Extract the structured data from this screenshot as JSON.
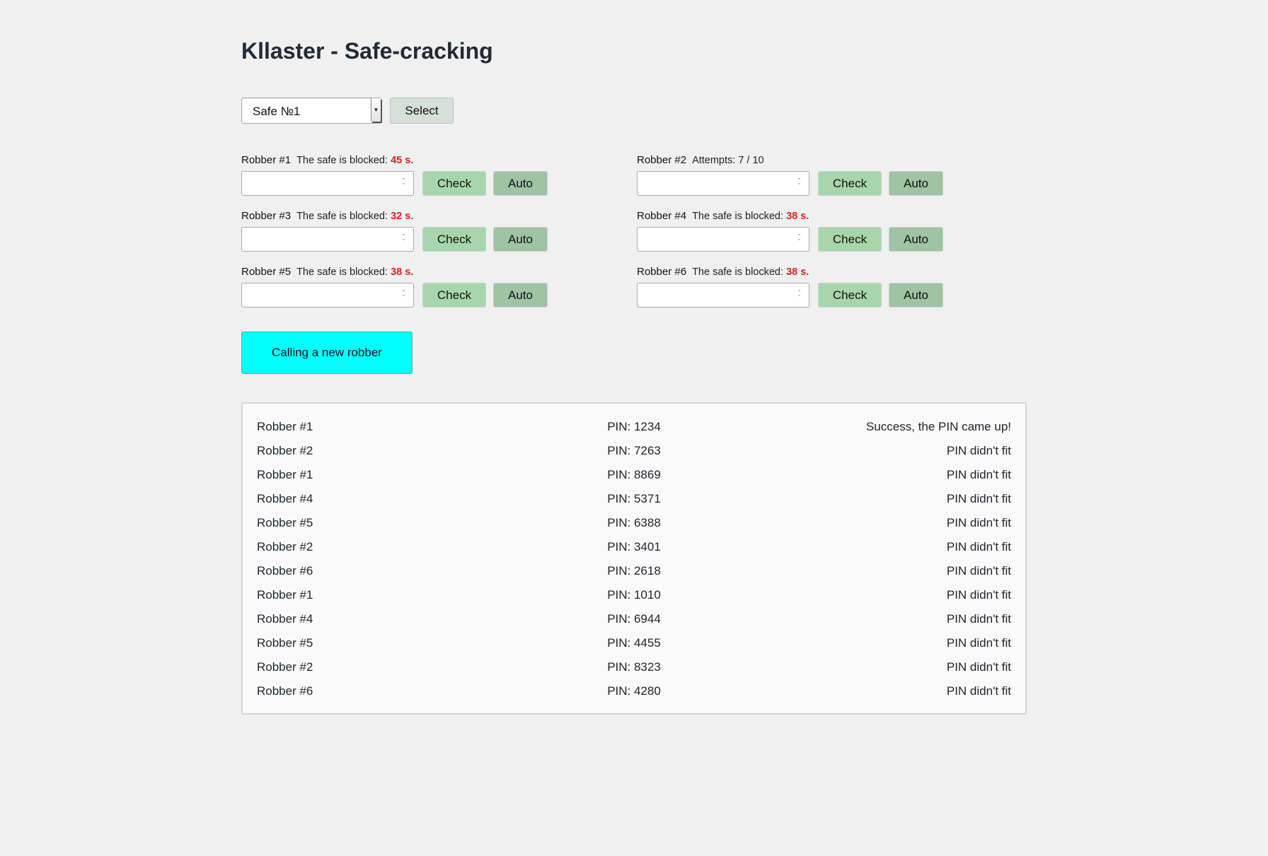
{
  "page_title": "Kllaster - Safe-cracking",
  "safe_select": {
    "value": "Safe №1",
    "button_label": "Select"
  },
  "robbers": [
    {
      "name": "Robber #1",
      "status": "The safe is blocked: ",
      "seconds": "45 s.",
      "check_label": "Check",
      "auto_label": "Auto"
    },
    {
      "name": "Robber #2",
      "status": "Attempts: 7 / 10",
      "seconds": "",
      "check_label": "Check",
      "auto_label": "Auto"
    },
    {
      "name": "Robber #3",
      "status": "The safe is blocked: ",
      "seconds": "32 s.",
      "check_label": "Check",
      "auto_label": "Auto"
    },
    {
      "name": "Robber #4",
      "status": "The safe is blocked: ",
      "seconds": "38 s.",
      "check_label": "Check",
      "auto_label": "Auto"
    },
    {
      "name": "Robber #5",
      "status": "The safe is blocked: ",
      "seconds": "38 s.",
      "check_label": "Check",
      "auto_label": "Auto"
    },
    {
      "name": "Robber #6",
      "status": "The safe is blocked: ",
      "seconds": "38 s.",
      "check_label": "Check",
      "auto_label": "Auto"
    }
  ],
  "call_button_label": "Calling a new robber",
  "log": [
    {
      "robber": "Robber #1",
      "pin": "PIN: 1234",
      "result": "Success, the PIN came up!"
    },
    {
      "robber": "Robber #2",
      "pin": "PIN: 7263",
      "result": "PIN didn't fit"
    },
    {
      "robber": "Robber #1",
      "pin": "PIN: 8869",
      "result": "PIN didn't fit"
    },
    {
      "robber": "Robber #4",
      "pin": "PIN: 5371",
      "result": "PIN didn't fit"
    },
    {
      "robber": "Robber #5",
      "pin": "PIN: 6388",
      "result": "PIN didn't fit"
    },
    {
      "robber": "Robber #2",
      "pin": "PIN: 3401",
      "result": "PIN didn't fit"
    },
    {
      "robber": "Robber #6",
      "pin": "PIN: 2618",
      "result": "PIN didn't fit"
    },
    {
      "robber": "Robber #1",
      "pin": "PIN: 1010",
      "result": "PIN didn't fit"
    },
    {
      "robber": "Robber #4",
      "pin": "PIN: 6944",
      "result": "PIN didn't fit"
    },
    {
      "robber": "Robber #5",
      "pin": "PIN: 4455",
      "result": "PIN didn't fit"
    },
    {
      "robber": "Robber #2",
      "pin": "PIN: 8323",
      "result": "PIN didn't fit"
    },
    {
      "robber": "Robber #6",
      "pin": "PIN: 4280",
      "result": "PIN didn't fit"
    }
  ],
  "colors": {
    "background": "#f0f0f0",
    "check_button": "#a8d6ac",
    "auto_button": "#9fc3a4",
    "call_button": "#00ffff",
    "blocked_seconds": "#e02020"
  },
  "icons": {
    "select_arrow": "dropdown-arrow-icon",
    "number_spinner": "spinner-arrows-icon"
  }
}
